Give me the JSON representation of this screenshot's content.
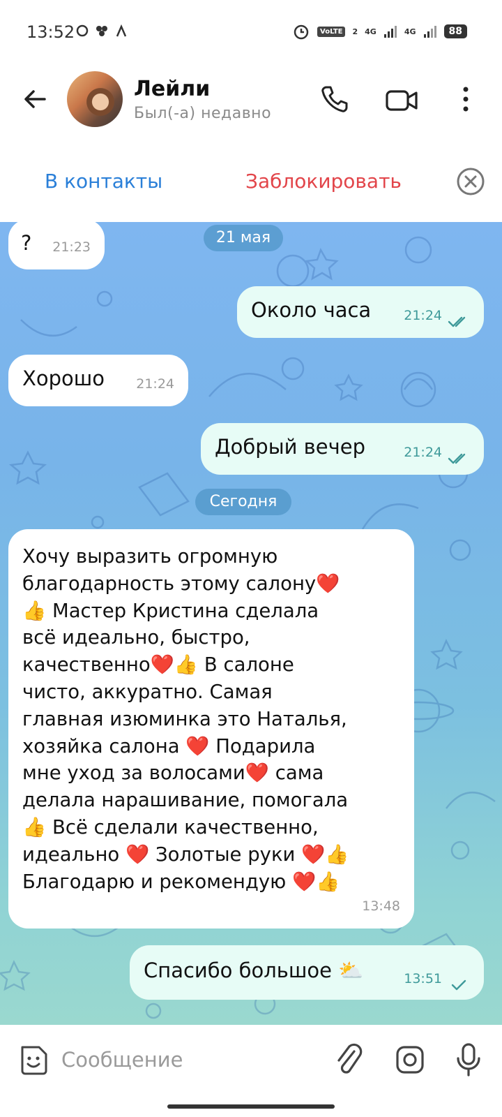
{
  "status_bar": {
    "time": "13:52",
    "volte": "VoLTE",
    "sim": "2",
    "net1": "4G",
    "net2": "4G",
    "battery": "88"
  },
  "header": {
    "contact_name": "Лейли",
    "contact_status": "Был(-а) недавно"
  },
  "action_bar": {
    "add_contact_label": "В контакты",
    "block_label": "Заблокировать"
  },
  "chat": {
    "date_1": "21 мая",
    "date_2": "Сегодня",
    "messages": [
      {
        "direction": "in",
        "text": "?",
        "time": "21:23"
      },
      {
        "direction": "out",
        "text": "Около часа",
        "time": "21:24",
        "status": "read"
      },
      {
        "direction": "in",
        "text": "Хорошо",
        "time": "21:24"
      },
      {
        "direction": "out",
        "text": "Добрый вечер",
        "time": "21:24",
        "status": "read"
      },
      {
        "direction": "in",
        "lines": [
          "Хочу выразить огромную",
          "благодарность этому салону❤️",
          "👍 Мастер Кристина сделала",
          "всё идеально, быстро,",
          "качественно❤️👍 В салоне",
          "чисто, аккуратно. Самая",
          "главная изюминка это Наталья,",
          "хозяйка салона ❤️ Подарила",
          "мне уход за волосами❤️ сама",
          "делала нарашивание, помогала",
          "👍  Всё сделали качественно,",
          "идеально ❤️ Золотые руки ❤️👍",
          "Благодарю и рекомендую ❤️👍"
        ],
        "time": "13:48"
      },
      {
        "direction": "out",
        "text": "Спасибо большое ⛅",
        "time": "13:51",
        "status": "sent"
      }
    ]
  },
  "input_bar": {
    "placeholder": "Сообщение"
  },
  "colors": {
    "accent_blue": "#2a7fd8",
    "block_red": "#e2454a",
    "outgoing_bubble": "#e7fcf6",
    "incoming_bubble": "#ffffff"
  }
}
